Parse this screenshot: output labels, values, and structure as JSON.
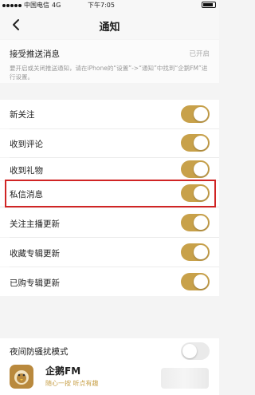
{
  "status_bar": {
    "carrier": "中国电信",
    "network": "4G",
    "time": "下午7:05"
  },
  "header": {
    "title": "通知"
  },
  "push": {
    "label": "接受推送消息",
    "status": "已开启",
    "description": "要开启或关闭推送通知，请在iPhone的“设置”->“通知”中找到“企鹅FM”进行设置。"
  },
  "settings": [
    {
      "label": "新关注",
      "enabled": true
    },
    {
      "label": "收到评论",
      "enabled": true
    },
    {
      "label": "收到礼物",
      "enabled": true
    },
    {
      "label": "私信消息",
      "enabled": true,
      "highlighted": true
    },
    {
      "label": "关注主播更新",
      "enabled": true
    },
    {
      "label": "收藏专辑更新",
      "enabled": true
    },
    {
      "label": "已购专辑更新",
      "enabled": true
    },
    {
      "label": "夜间防骚扰模式",
      "enabled": false
    }
  ],
  "banner": {
    "app_name": "企鹅FM",
    "slogan": "随心一按  听点有趣"
  },
  "colors": {
    "accent": "#c8a14a",
    "highlight_border": "#d02424",
    "toggle_off": "#eaeaea"
  },
  "icons": {
    "back": "chevron-left-icon",
    "logo": "penguin-fm-logo"
  }
}
